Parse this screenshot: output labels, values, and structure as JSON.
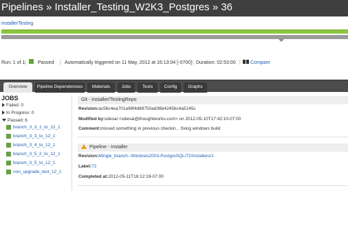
{
  "header": {
    "title": "Pipelines » Installer_Testing_W2K3_Postgres » 36"
  },
  "stage": {
    "link_label": "installerTesting"
  },
  "run": {
    "run_label": "Run: 1 of 1",
    "status": "Passed",
    "trigger": "Automatically triggered on 11 May, 2012 at 16:13:04 [-0700]",
    "duration": "Duration: 02:53:00",
    "compare_label": "Compare",
    "status_color": "#63a33b"
  },
  "tabs": [
    {
      "label": "Overview",
      "active": true
    },
    {
      "label": "Pipeline Dependencies"
    },
    {
      "label": "Materials"
    },
    {
      "label": "Jobs"
    },
    {
      "label": "Tests"
    },
    {
      "label": "Config"
    },
    {
      "label": "Graphs"
    }
  ],
  "sidebar": {
    "title": "JOBS",
    "failed": "Failed: 0",
    "in_progress": "In Progress: 0",
    "passed": "Passed: 6",
    "jobs": [
      "branch_3_3_1_to_12_1",
      "branch_3_3_to_12_1",
      "branch_3_4_to_12_1",
      "branch_3_5_2_to_12_1",
      "branch_3_5_to_12_1",
      "non_upgrade_test_12_1"
    ]
  },
  "materials": {
    "git": {
      "header": "Git - Installer/TestingRepo",
      "revision_key": "Revision:",
      "revision_value": "ac56c4ea701a98f4d89750ad36b4245bc4a5145c",
      "modified_key": "Modified by:",
      "modified_value": "sdesai <sdesai@thoughtworks.com> on 2012-05-10T17:42:10-07:00",
      "comment_key": "Comment:",
      "comment_value": "missed something in previous checkin... fixing windows build"
    },
    "pipeline": {
      "header": "Pipeline - Installer",
      "revision_key": "Revision:",
      "revision_value": "Mingle_branch--Windows2003-PostgreSQL/72/Installers/1",
      "label_key": "Label:",
      "label_value": "72",
      "completed_key": "Completed at:",
      "completed_value": "2012-05-11T16:12:19-07:00"
    }
  }
}
